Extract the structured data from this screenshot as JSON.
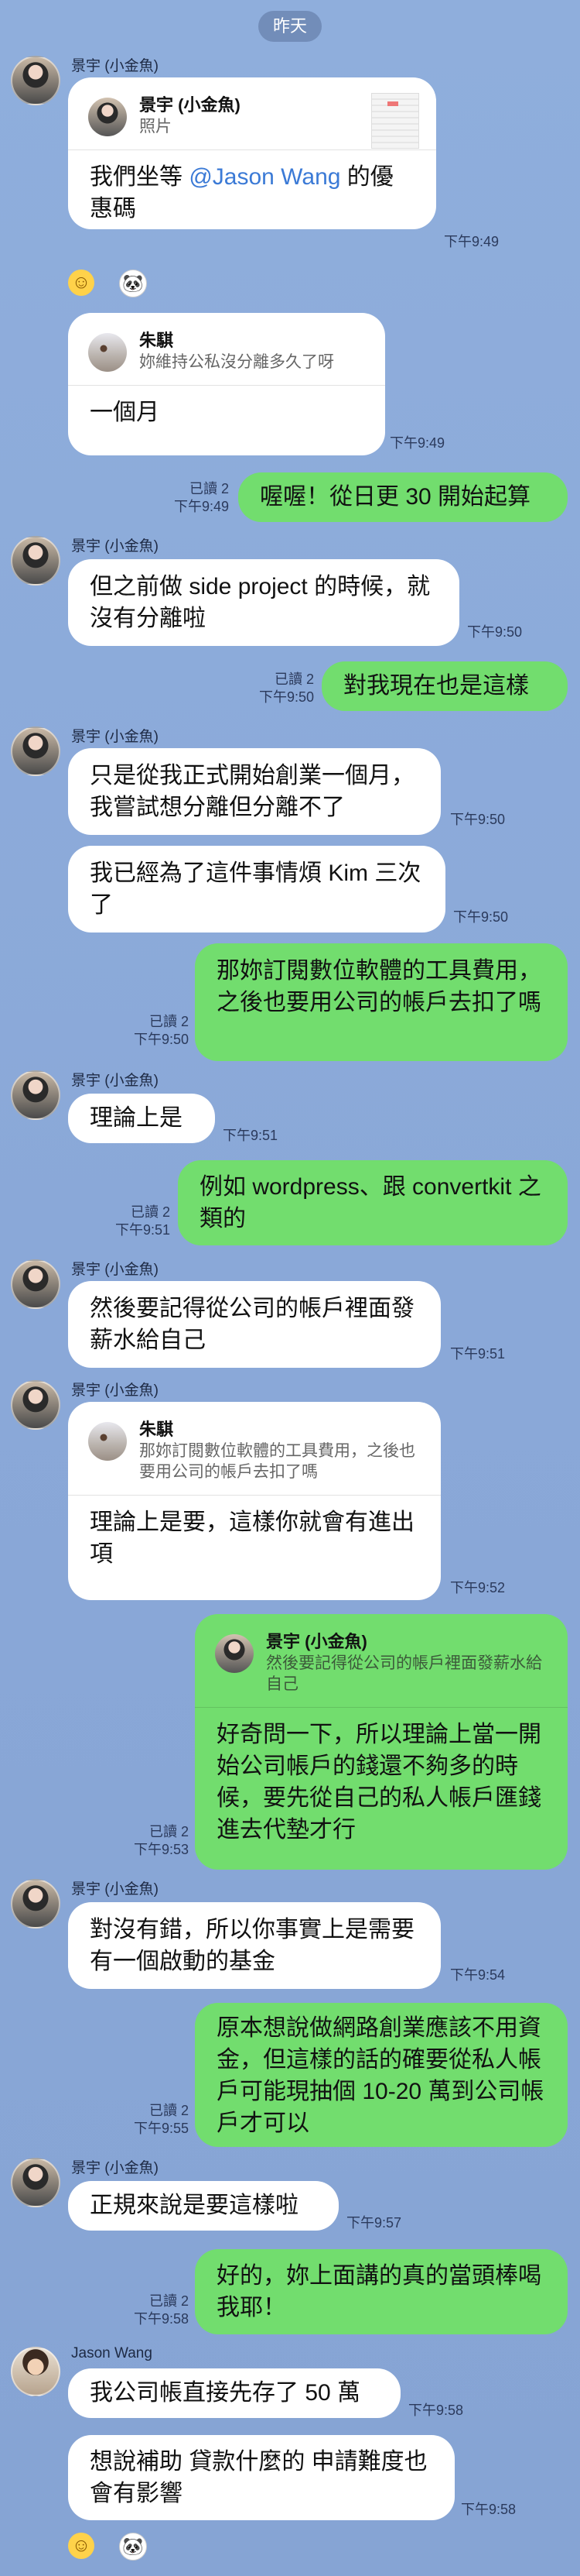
{
  "date_label": "昨天",
  "messages": [
    {
      "sender": "景宇 (小金魚)",
      "quote_name": "景宇 (小金魚)",
      "quote_text": "照片",
      "text_before": "我們坐等 ",
      "mention": "@Jason Wang",
      "text_after": " 的優惠碼",
      "time": "下午9:49"
    },
    {
      "quote_name": "朱騏",
      "quote_text": "妳維持公私沒分離多久了呀",
      "text": "一個月",
      "time": "下午9:49"
    },
    {
      "read": "已讀 2",
      "time": "下午9:49",
      "text": "喔喔！從日更 30 開始起算"
    },
    {
      "sender": "景宇 (小金魚)",
      "text": "但之前做 side project 的時候，就沒有分離啦",
      "time": "下午9:50"
    },
    {
      "read": "已讀 2",
      "time": "下午9:50",
      "text": "對我現在也是這樣"
    },
    {
      "sender": "景宇 (小金魚)",
      "text": "只是從我正式開始創業一個月，我嘗試想分離但分離不了",
      "time": "下午9:50"
    },
    {
      "text": "我已經為了這件事情煩 Kim 三次了",
      "time": "下午9:50"
    },
    {
      "read": "已讀 2",
      "time": "下午9:50",
      "text": "那妳訂閱數位軟體的工具費用，之後也要用公司的帳戶去扣了嗎"
    },
    {
      "sender": "景宇 (小金魚)",
      "text": "理論上是",
      "time": "下午9:51"
    },
    {
      "read": "已讀 2",
      "time": "下午9:51",
      "text": "例如 wordpress、跟 convertkit 之類的"
    },
    {
      "sender": "景宇 (小金魚)",
      "text": "然後要記得從公司的帳戶裡面發薪水給自己",
      "time": "下午9:51"
    },
    {
      "sender": "景宇 (小金魚)",
      "quote_name": "朱騏",
      "quote_text": "那妳訂閱數位軟體的工具費用，之後也要用公司的帳戶去扣了嗎",
      "text": "理論上是要，這樣你就會有進出項",
      "time": "下午9:52"
    },
    {
      "quote_name": "景宇 (小金魚)",
      "quote_text": "然後要記得從公司的帳戶裡面發薪水給自己",
      "read": "已讀 2",
      "time": "下午9:53",
      "text": "好奇問一下，所以理論上當一開始公司帳戶的錢還不夠多的時候，要先從自己的私人帳戶匯錢進去代墊才行"
    },
    {
      "sender": "景宇 (小金魚)",
      "text": "對沒有錯，所以你事實上是需要有一個啟動的基金",
      "time": "下午9:54"
    },
    {
      "read": "已讀 2",
      "time": "下午9:55",
      "text": "原本想說做網路創業應該不用資金，但這樣的話的確要從私人帳戶可能現抽個 10-20 萬到公司帳戶才可以"
    },
    {
      "sender": "景宇 (小金魚)",
      "text": "正規來說是要這樣啦",
      "time": "下午9:57"
    },
    {
      "read": "已讀 2",
      "time": "下午9:58",
      "text": "好的，妳上面講的真的當頭棒喝我耶！"
    },
    {
      "sender": "Jason Wang",
      "text": "我公司帳直接先存了 50 萬",
      "time": "下午9:58"
    },
    {
      "text": "想說補助 貸款什麼的 申請難度也會有影響",
      "time": "下午9:58"
    }
  ],
  "reactions": [
    {
      "icon": "smile-emoji-icon",
      "glyph": "☺"
    },
    {
      "icon": "panda-sticker-icon",
      "glyph": "🐼"
    }
  ],
  "colors": {
    "outgoing": "#72dd6e",
    "incoming": "#ffffff",
    "mention": "#3b7ad6",
    "background": "#8aa8d8"
  }
}
